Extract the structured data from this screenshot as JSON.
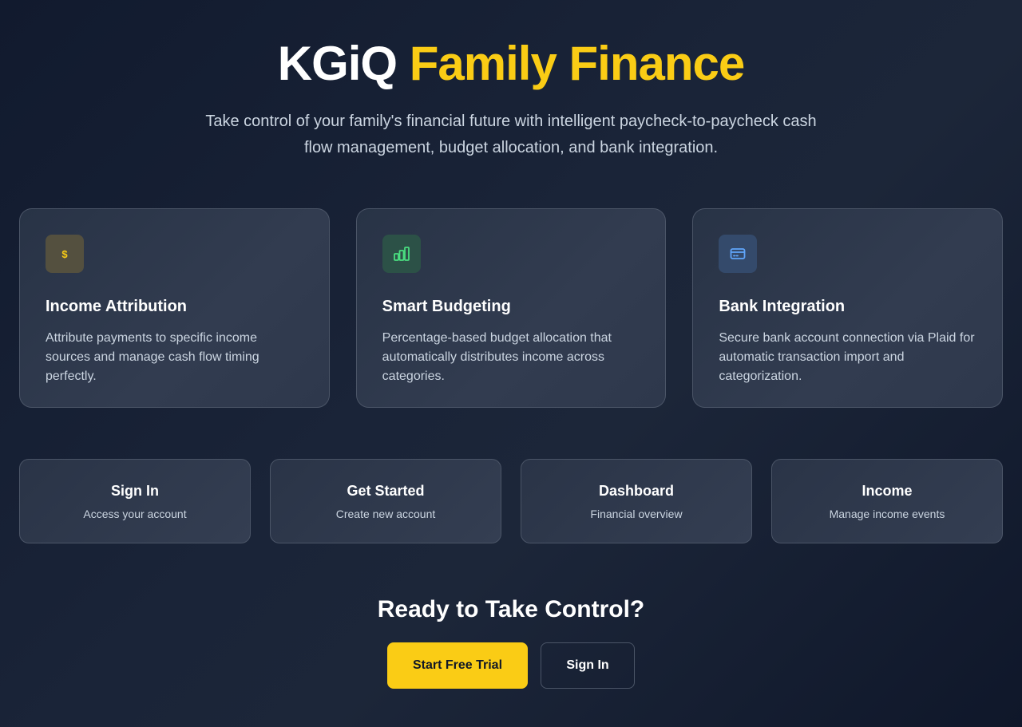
{
  "hero": {
    "title_brand": "KGiQ",
    "title_accent": "Family Finance",
    "subtitle": "Take control of your family's financial future with intelligent paycheck-to-paycheck cash flow management, budget allocation, and bank integration."
  },
  "features": [
    {
      "icon": "dollar-icon",
      "icon_glyph": "$",
      "title": "Income Attribution",
      "description": "Attribute payments to specific income sources and manage cash flow timing perfectly."
    },
    {
      "icon": "bar-chart-icon",
      "title": "Smart Budgeting",
      "description": "Percentage-based budget allocation that automatically distributes income across categories."
    },
    {
      "icon": "credit-card-icon",
      "title": "Bank Integration",
      "description": "Secure bank account connection via Plaid for automatic transaction import and categorization."
    }
  ],
  "quick_links": [
    {
      "title": "Sign In",
      "subtitle": "Access your account"
    },
    {
      "title": "Get Started",
      "subtitle": "Create new account"
    },
    {
      "title": "Dashboard",
      "subtitle": "Financial overview"
    },
    {
      "title": "Income",
      "subtitle": "Manage income events"
    }
  ],
  "cta": {
    "title": "Ready to Take Control?",
    "primary_label": "Start Free Trial",
    "secondary_label": "Sign In"
  },
  "colors": {
    "accent": "#facc15",
    "background": "#1a2438",
    "green_icon": "#4ade80",
    "blue_icon": "#60a5fa"
  }
}
